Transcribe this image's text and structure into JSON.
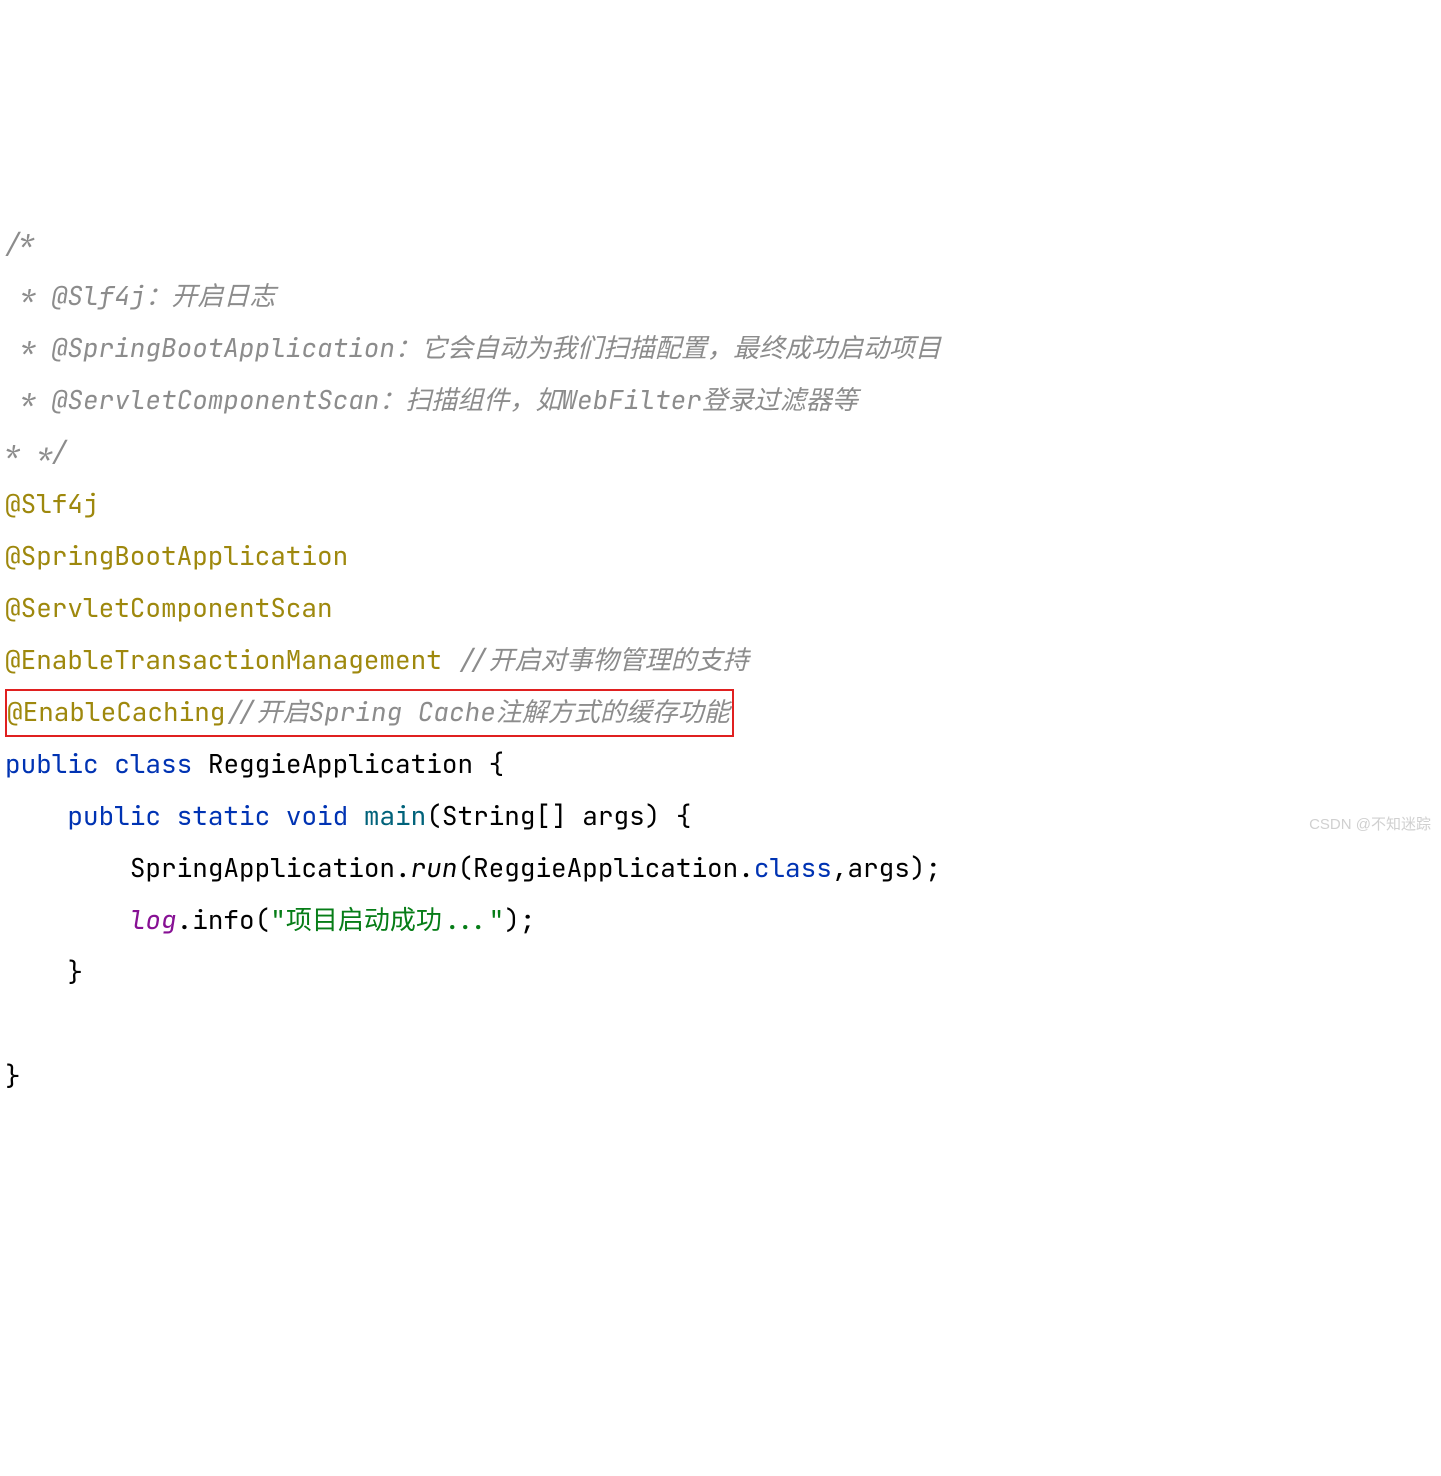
{
  "code": {
    "c1": "/*",
    "c2": " * @Slf4j：开启日志",
    "c3": " * @SpringBootApplication：它会自动为我们扫描配置，最终成功启动项目",
    "c4": " * @ServletComponentScan：扫描组件，如WebFilter登录过滤器等",
    "c5": "* */",
    "a1": "@Slf4j",
    "a2": "@SpringBootApplication",
    "a3": "@ServletComponentScan",
    "a4": "@EnableTransactionManagement",
    "a4c": " //开启对事物管理的支持",
    "a5": "@EnableCaching",
    "a5c": "//开启Spring Cache注解方式的缓存功能",
    "kw_public1": "public",
    "kw_class": "class",
    "cls_name": "ReggieApplication",
    "brace_open1": " {",
    "indent1": "    ",
    "kw_public2": "public",
    "kw_static": "static",
    "kw_void": "void",
    "m_main": "main",
    "main_params": "(String[] args) {",
    "indent2": "        ",
    "spring_app": "SpringApplication.",
    "run_m": "run",
    "run_args": "(ReggieApplication.",
    "kw_class2": "class",
    "run_args2": ",args);",
    "log_var": "log",
    "info_call": ".info(",
    "info_str": "\"项目启动成功...\"",
    "info_end": ");",
    "brace_close2": "    }",
    "brace_close1": "}"
  },
  "watermark": "CSDN @不知迷踪"
}
